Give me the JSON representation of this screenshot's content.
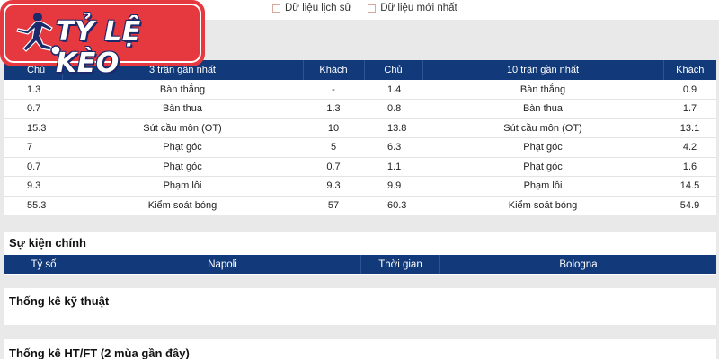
{
  "filters": {
    "history_label": "Dữ liệu lịch sử",
    "latest_label": "Dữ liệu mới nhất"
  },
  "logo": {
    "text": "TỶ LỆ KÈO"
  },
  "stats_table": {
    "headers": {
      "home_a": "Chủ",
      "range_a": "3 trận gần nhất",
      "away_a": "Khách",
      "home_b": "Chủ",
      "range_b": "10 trận gần nhất",
      "away_b": "Khách"
    },
    "rows": [
      {
        "h3": "1.3",
        "label3": "Bàn thắng",
        "a3": "-",
        "h10": "1.4",
        "label10": "Bàn thắng",
        "a10": "0.9"
      },
      {
        "h3": "0.7",
        "label3": "Bàn thua",
        "a3": "1.3",
        "h10": "0.8",
        "label10": "Bàn thua",
        "a10": "1.7"
      },
      {
        "h3": "15.3",
        "label3": "Sút cầu môn (OT)",
        "a3": "10",
        "h10": "13.8",
        "label10": "Sút cầu môn (OT)",
        "a10": "13.1"
      },
      {
        "h3": "7",
        "label3": "Phạt góc",
        "a3": "5",
        "h10": "6.3",
        "label10": "Phạt góc",
        "a10": "4.2"
      },
      {
        "h3": "0.7",
        "label3": "Phạt góc",
        "a3": "0.7",
        "h10": "1.1",
        "label10": "Phạt góc",
        "a10": "1.6"
      },
      {
        "h3": "9.3",
        "label3": "Phạm lỗi",
        "a3": "9.3",
        "h10": "9.9",
        "label10": "Phạm lỗi",
        "a10": "14.5"
      },
      {
        "h3": "55.3",
        "label3": "Kiểm soát bóng",
        "a3": "57",
        "h10": "60.3",
        "label10": "Kiểm soát bóng",
        "a10": "54.9"
      }
    ]
  },
  "events": {
    "title": "Sự kiện chính",
    "headers": {
      "score": "Tỷ số",
      "home_team": "Napoli",
      "time": "Thời gian",
      "away_team": "Bologna"
    }
  },
  "technical": {
    "title": "Thống kê kỹ thuật"
  },
  "htft": {
    "title": "Thống kê HT/FT (2 mùa gần đây)"
  },
  "colors": {
    "header_blue": "#123a7a",
    "logo_red": "#e5383f",
    "logo_outline": "#1c2a6b"
  }
}
